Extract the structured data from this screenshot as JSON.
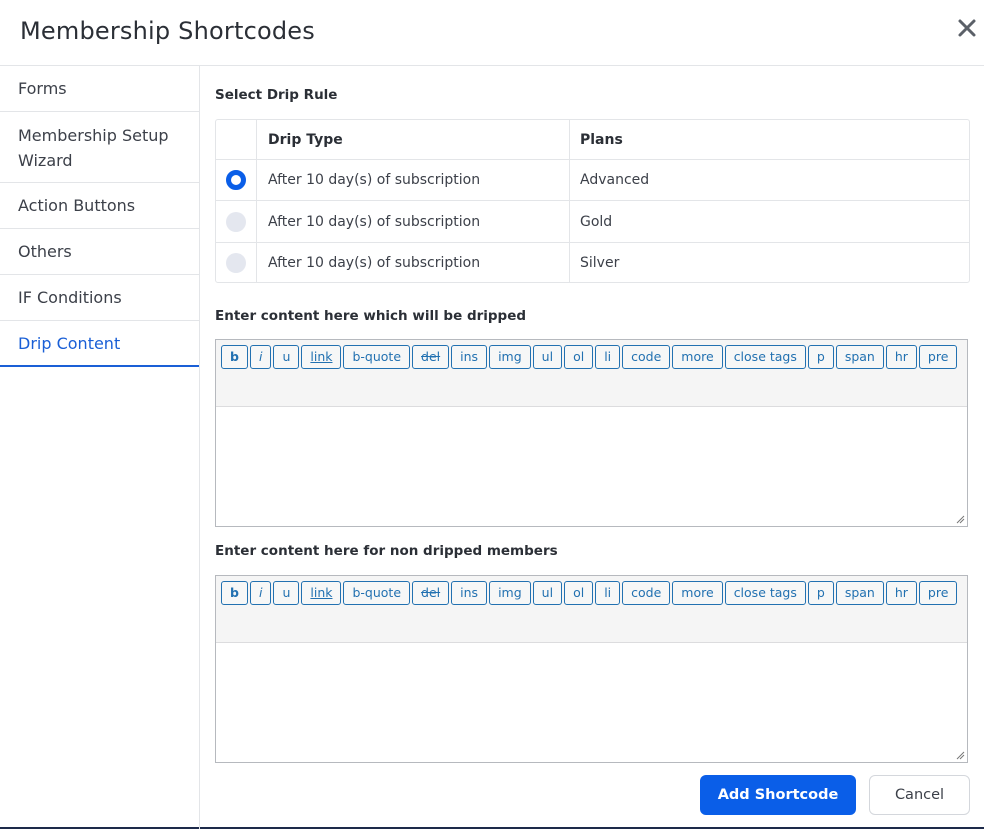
{
  "dialog": {
    "title": "Membership Shortcodes",
    "close_icon": "close-icon"
  },
  "sidebar": {
    "items": [
      {
        "label": "Forms"
      },
      {
        "label": "Membership Setup Wizard"
      },
      {
        "label": "Action Buttons"
      },
      {
        "label": "Others"
      },
      {
        "label": "IF Conditions"
      },
      {
        "label": "Drip Content",
        "active": true
      }
    ]
  },
  "drip": {
    "section_label": "Select Drip Rule",
    "columns": {
      "type": "Drip Type",
      "plans": "Plans"
    },
    "rows": [
      {
        "type": "After 10 day(s) of subscription",
        "plan": "Advanced",
        "selected": true
      },
      {
        "type": "After 10 day(s) of subscription",
        "plan": "Gold",
        "selected": false
      },
      {
        "type": "After 10 day(s) of subscription",
        "plan": "Silver",
        "selected": false
      }
    ]
  },
  "editor_dripped": {
    "label": "Enter content here which will be dripped"
  },
  "editor_non_dripped": {
    "label": "Enter content here for non dripped members"
  },
  "toolbar_buttons": [
    "b",
    "i",
    "u",
    "link",
    "b-quote",
    "del",
    "ins",
    "img",
    "ul",
    "ol",
    "li",
    "code",
    "more",
    "close tags",
    "p",
    "span",
    "hr",
    "pre"
  ],
  "footer": {
    "add_label": "Add Shortcode",
    "cancel_label": "Cancel"
  },
  "colors": {
    "accent": "#0a5ee8",
    "active_nav": "#1a5fd6",
    "quicktag": "#2271b1"
  }
}
